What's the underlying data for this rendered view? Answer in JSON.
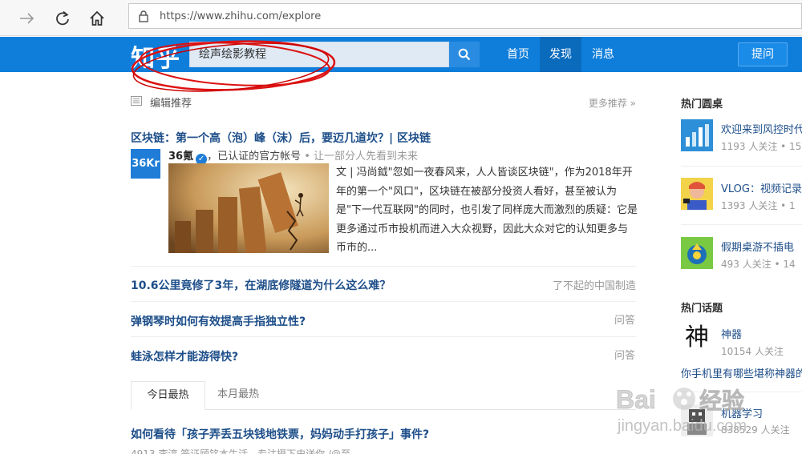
{
  "browser": {
    "url": "https://www.zhihu.com/explore",
    "icons": [
      "arrow-right-icon",
      "refresh-icon",
      "home-icon",
      "lock-icon"
    ]
  },
  "header": {
    "logo": "知乎",
    "search_value": "绘声绘影教程",
    "nav": [
      "首页",
      "发现",
      "消息"
    ],
    "active_nav": "发现",
    "ask_label": "提问",
    "brand_color": "#0f7edb"
  },
  "main": {
    "section_title": "编辑推荐",
    "more_label": "更多推荐 »",
    "featured": {
      "title": "区块链：第一个高（泡）峰（沫）后，要迈几道坎？| 区块链",
      "avatar_text": "36Kr",
      "author": "36氪",
      "author_desc": "，已认证的官方帐号",
      "author_sub": " • 让一部分人先看到未来",
      "excerpt": "文 | 冯尚鉞\"忽如一夜春风来，人人皆谈区块链\"，作为2018年开年的第一个\"风口\"，区块链在被部分投资人看好，甚至被认为是\"下一代互联网\"的同时，也引发了同样庞大而激烈的质疑：它是更多通过币市投机而进入大众视野，因此大众对它的认知更多与币市的..."
    },
    "questions": [
      {
        "title": "10.6公里竟修了3年，在湖底修隧道为什么这么难？",
        "tag": "了不起的中国制造"
      },
      {
        "title": "弹钢琴时如何有效提高手指独立性?",
        "tag": "问答"
      },
      {
        "title": "蛙泳怎样才能游得快?",
        "tag": "问答"
      }
    ],
    "tabs": [
      "今日最热",
      "本月最热"
    ],
    "hot_title": "如何看待「孩子弄丢五块钱地铁票，妈妈动手打孩子」事件?",
    "hot_cut": "4913    李淳    签证顾铭本生活，专注摄下史送你    /@至"
  },
  "sidebar": {
    "roundtable_head": "热门圆桌",
    "roundtables": [
      {
        "title": "欢迎来到风控时代",
        "meta": "1193 人关注 • 15"
      },
      {
        "title": "VLOG：视频记录",
        "meta": "1393 人关注 • 1"
      },
      {
        "title": "假期桌游不插电",
        "meta": "493 人关注 • 14"
      }
    ],
    "topics_head": "热门话题",
    "topics": [
      {
        "glyph": "神",
        "title": "神器",
        "meta": "10154 人关注",
        "desc": "你手机里有哪些堪称神器的"
      },
      {
        "title": "机器学习",
        "meta": "838529 人关注"
      }
    ]
  },
  "watermark": {
    "brand": "Bai",
    "brand_cn": "经验",
    "url": "jingyan.baidu.com"
  }
}
